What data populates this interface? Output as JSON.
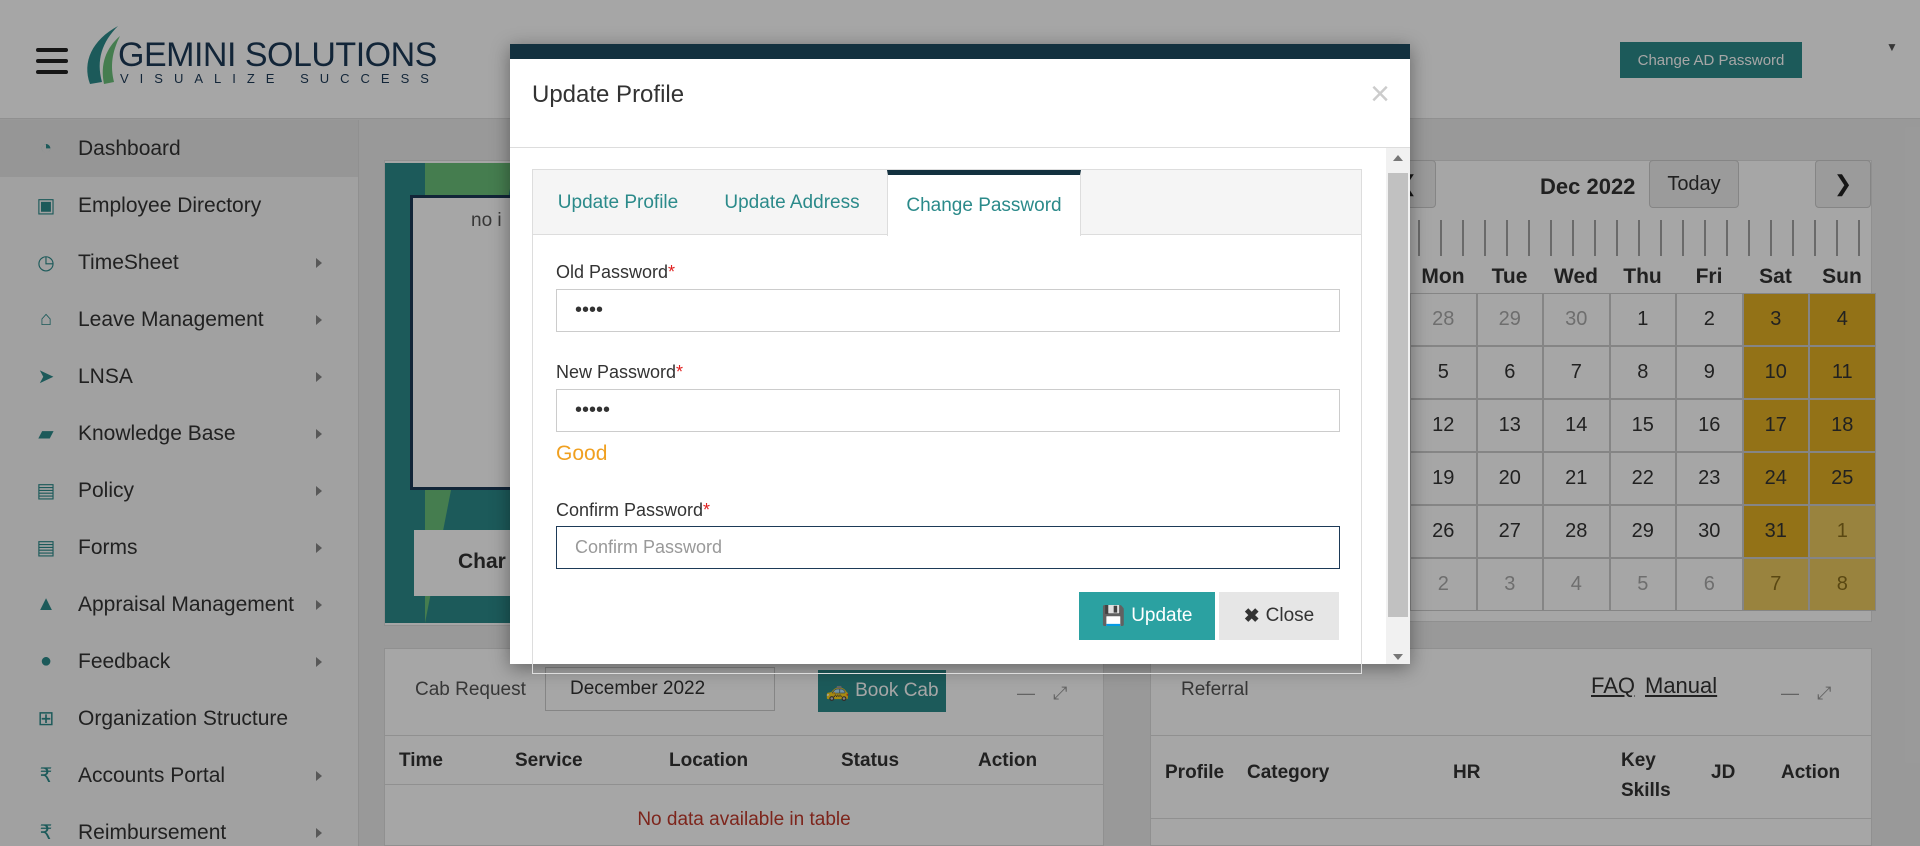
{
  "header": {
    "logo_main": "GEMINI SOLUTIONS",
    "logo_sub": "VISUALIZE SUCCESS",
    "change_ad_password": "Change AD Password"
  },
  "sidebar": {
    "items": [
      {
        "label": "Dashboard",
        "icon": "dashboard-icon",
        "glyph": "◔"
      },
      {
        "label": "Employee Directory",
        "icon": "directory-icon",
        "glyph": "▣"
      },
      {
        "label": "TimeSheet",
        "icon": "clock-icon",
        "glyph": "◷"
      },
      {
        "label": "Leave Management",
        "icon": "home-icon",
        "glyph": "⌂"
      },
      {
        "label": "LNSA",
        "icon": "send-icon",
        "glyph": "➤"
      },
      {
        "label": "Knowledge Base",
        "icon": "folder-icon",
        "glyph": "▰"
      },
      {
        "label": "Policy",
        "icon": "file-icon",
        "glyph": "▤"
      },
      {
        "label": "Forms",
        "icon": "file-icon",
        "glyph": "▤"
      },
      {
        "label": "Appraisal Management",
        "icon": "graduation-cap-icon",
        "glyph": "▲"
      },
      {
        "label": "Feedback",
        "icon": "comments-icon",
        "glyph": "●"
      },
      {
        "label": "Organization Structure",
        "icon": "sitemap-icon",
        "glyph": "⊞"
      },
      {
        "label": "Accounts Portal",
        "icon": "rupee-icon",
        "glyph": "₹"
      },
      {
        "label": "Reimbursement",
        "icon": "rupee-icon",
        "glyph": "₹"
      }
    ]
  },
  "background": {
    "no_image_text": "no i",
    "char_text": "Char",
    "calendar": {
      "title": "Dec 2022",
      "today": "Today",
      "prev": "❮",
      "next": "❯",
      "days": [
        "Mon",
        "Tue",
        "Wed",
        "Thu",
        "Fri",
        "Sat",
        "Sun"
      ],
      "weeks": [
        [
          "28",
          "29",
          "30",
          "1",
          "2",
          "3",
          "4"
        ],
        [
          "5",
          "6",
          "7",
          "8",
          "9",
          "10",
          "11"
        ],
        [
          "12",
          "13",
          "14",
          "15",
          "16",
          "17",
          "18"
        ],
        [
          "19",
          "20",
          "21",
          "22",
          "23",
          "24",
          "25"
        ],
        [
          "26",
          "27",
          "28",
          "29",
          "30",
          "31",
          "1"
        ],
        [
          "2",
          "3",
          "4",
          "5",
          "6",
          "7",
          "8"
        ]
      ]
    },
    "cab": {
      "title": "Cab Request",
      "month": "December 2022",
      "book": "Book Cab",
      "columns": [
        "Time",
        "Service",
        "Location",
        "Status",
        "Action"
      ],
      "empty": "No data available in table"
    },
    "referral": {
      "title": "Referral",
      "faq": "FAQ",
      "manual": "Manual",
      "columns": [
        "Profile",
        "Category",
        "HR",
        "Key Skills",
        "JD",
        "Action"
      ]
    }
  },
  "modal": {
    "title": "Update Profile",
    "close_x": "×",
    "tabs": [
      {
        "label": "Update Profile",
        "active": false
      },
      {
        "label": "Update Address",
        "active": false
      },
      {
        "label": "Change Password",
        "active": true
      }
    ],
    "old_password": {
      "label": "Old Password",
      "value": "••••"
    },
    "new_password": {
      "label": "New Password",
      "value": "•••••",
      "strength": "Good"
    },
    "confirm_password": {
      "label": "Confirm Password",
      "value": "",
      "placeholder": "Confirm Password"
    },
    "required_mark": "*",
    "update_button": "Update",
    "close_button": "Close"
  },
  "colors": {
    "accent": "#2b8a8a",
    "modal_border": "#13313f",
    "weekend": "#e2b024",
    "strength_good": "#f0a020",
    "required": "#e02020"
  }
}
